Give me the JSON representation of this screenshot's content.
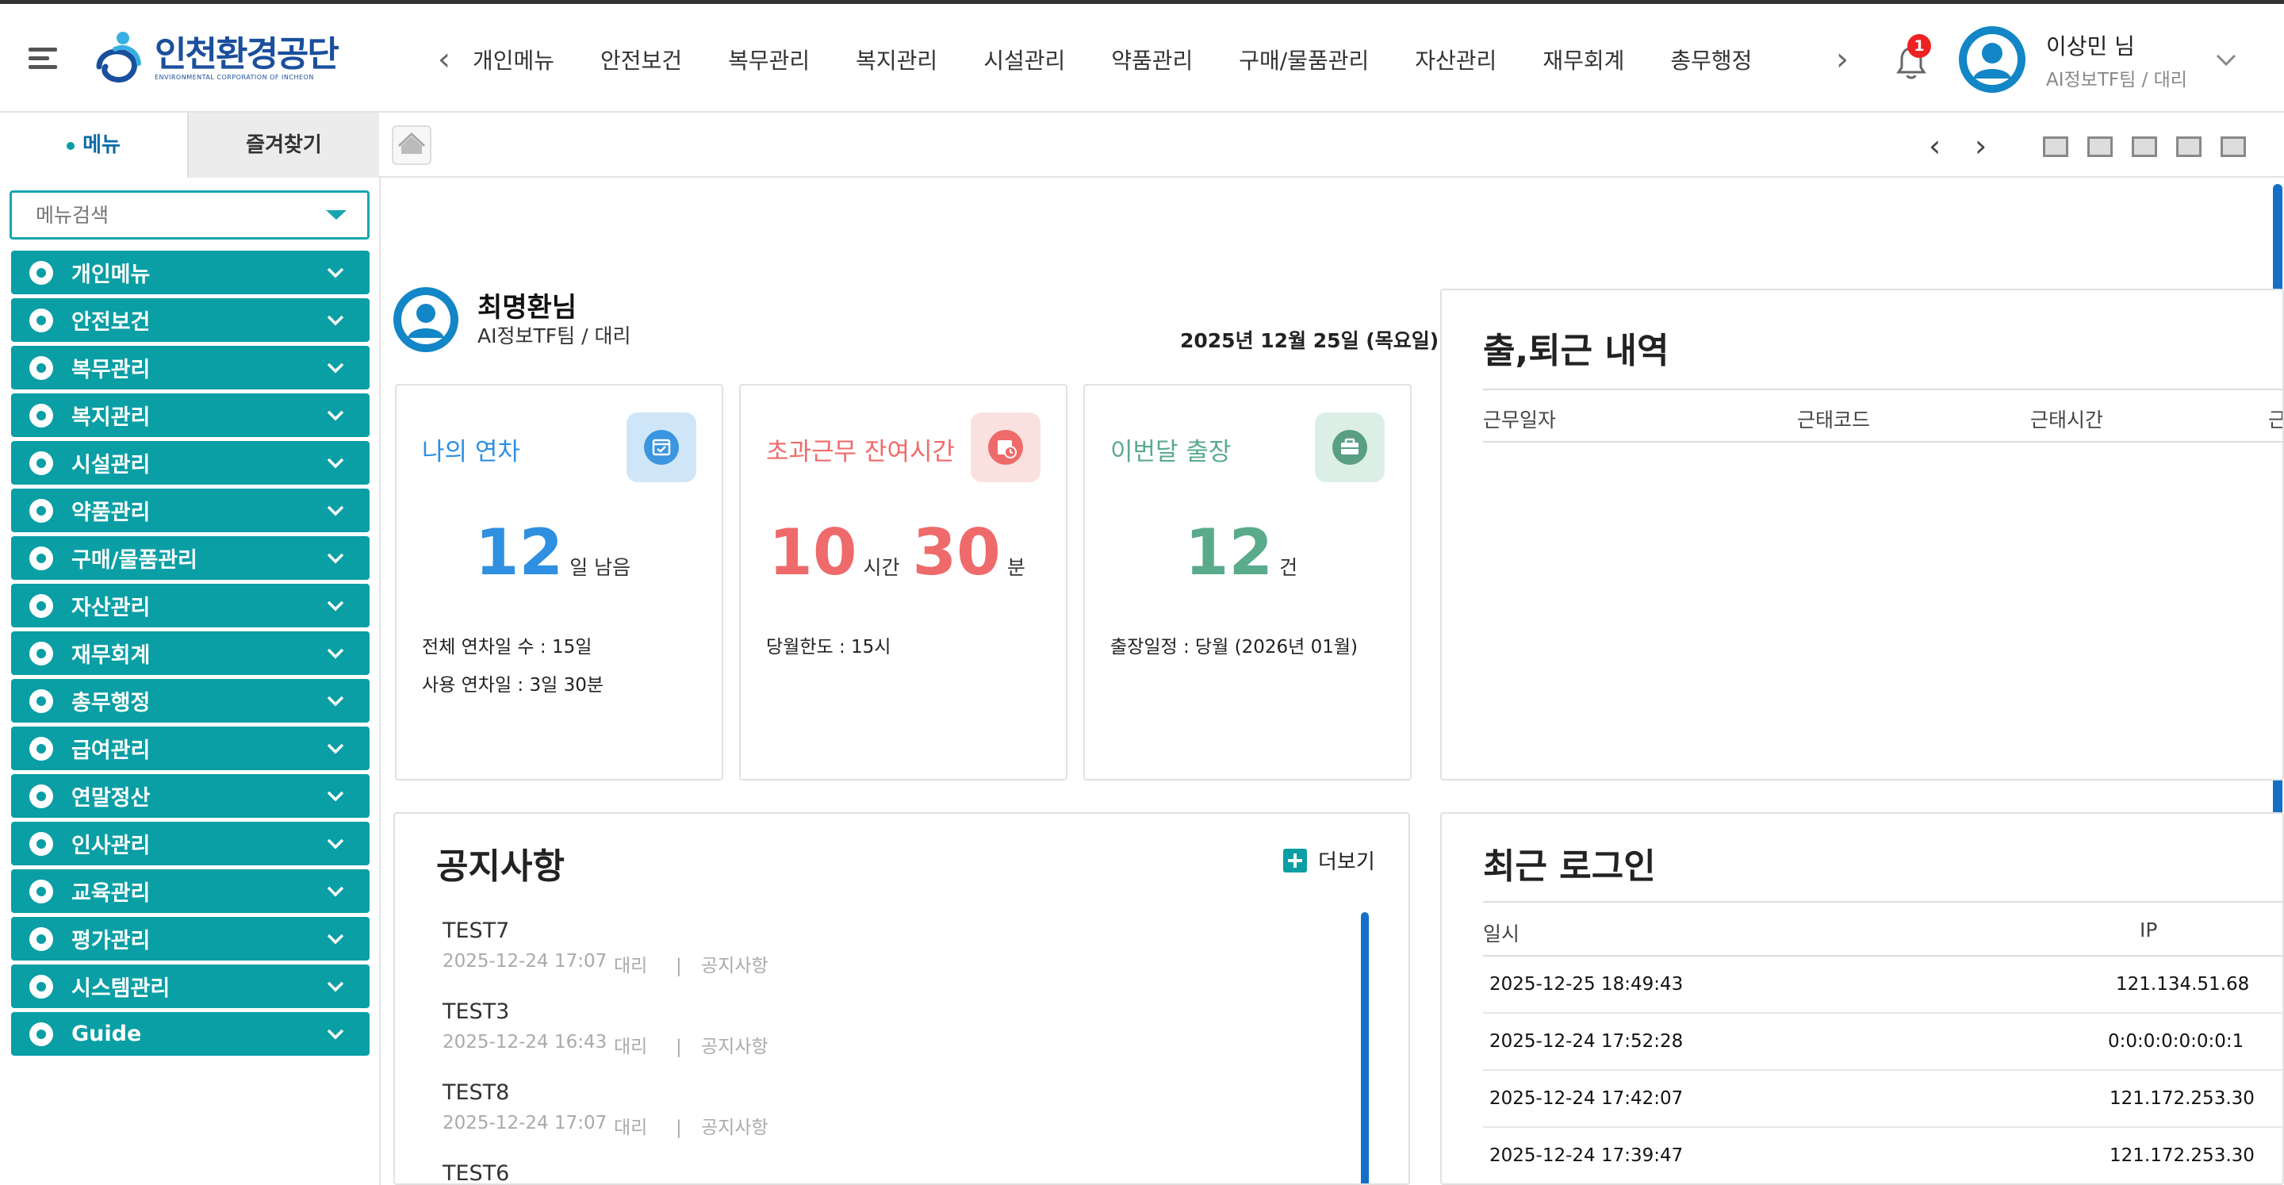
{
  "header": {
    "logo_ko": "인천환경공단",
    "logo_en": "ENVIRONMENTAL CORPORATION OF INCHEON",
    "nav": [
      "개인메뉴",
      "안전보건",
      "복무관리",
      "복지관리",
      "시설관리",
      "약품관리",
      "구매/물품관리",
      "자산관리",
      "재무회계",
      "총무행정"
    ],
    "notification_count": "1",
    "user_name": "이상민 님",
    "user_team": "AI정보TF팀 / 대리"
  },
  "tabs": {
    "menu": "메뉴",
    "favorites": "즐겨찾기"
  },
  "sidebar": {
    "search_placeholder": "메뉴검색",
    "items": [
      {
        "label": "개인메뉴",
        "icon": "id-card-icon"
      },
      {
        "label": "안전보건",
        "icon": "shield-icon"
      },
      {
        "label": "복무관리",
        "icon": "clock-user-icon"
      },
      {
        "label": "복지관리",
        "icon": "welfare-icon"
      },
      {
        "label": "시설관리",
        "icon": "tools-icon"
      },
      {
        "label": "약품관리",
        "icon": "truck-icon"
      },
      {
        "label": "구매/물품관리",
        "icon": "box-icon"
      },
      {
        "label": "자산관리",
        "icon": "database-icon"
      },
      {
        "label": "재무회계",
        "icon": "calculator-icon"
      },
      {
        "label": "총무행정",
        "icon": "bank-icon"
      },
      {
        "label": "급여관리",
        "icon": "won-icon"
      },
      {
        "label": "연말정산",
        "icon": "receipt-icon"
      },
      {
        "label": "인사관리",
        "icon": "person-frame-icon"
      },
      {
        "label": "교육관리",
        "icon": "book-icon"
      },
      {
        "label": "평가관리",
        "icon": "stamp-icon"
      },
      {
        "label": "시스템관리",
        "icon": "gear-icon"
      },
      {
        "label": "Guide",
        "icon": "help-icon"
      }
    ]
  },
  "profile": {
    "name": "최명환님",
    "team": "AI정보TF팀 / 대리",
    "date": "2025년 12월 25일 (목요일)"
  },
  "cards": {
    "leave": {
      "title": "나의 연차",
      "value": "12",
      "unit": "일 남음",
      "line1": "전체 연차일 수 : 15일",
      "line2": "사용 연차일 : 3일 30분",
      "color": "#2f8fe0"
    },
    "overtime": {
      "title": "초과근무 잔여시간",
      "hours": "10",
      "hours_unit": "시간",
      "minutes": "30",
      "minutes_unit": "분",
      "line1": "당월한도 : 15시",
      "color": "#ef6a6a"
    },
    "trip": {
      "title": "이번달 출장",
      "value": "12",
      "unit": "건",
      "line1": "출장일정 : 당월 (2026년 01월)",
      "color": "#5aaa8c"
    }
  },
  "attendance": {
    "title": "출,퇴근 내역",
    "columns": [
      "근무일자",
      "근태코드",
      "근태시간",
      "근"
    ]
  },
  "notice": {
    "title": "공지사항",
    "more": "더보기",
    "items": [
      {
        "title": "TEST7",
        "date": "2025-12-24 17:07",
        "rank": "대리",
        "sep": "|",
        "category": "공지사항"
      },
      {
        "title": "TEST3",
        "date": "2025-12-24 16:43",
        "rank": "대리",
        "sep": "|",
        "category": "공지사항"
      },
      {
        "title": "TEST8",
        "date": "2025-12-24 17:07",
        "rank": "대리",
        "sep": "|",
        "category": "공지사항"
      },
      {
        "title": "TEST6",
        "date": "",
        "rank": "",
        "sep": "",
        "category": ""
      }
    ]
  },
  "recent_login": {
    "title": "최근 로그인",
    "columns": [
      "일시",
      "IP"
    ],
    "rows": [
      {
        "time": "2025-12-25 18:49:43",
        "ip": "121.134.51.68"
      },
      {
        "time": "2025-12-24 17:52:28",
        "ip": "0:0:0:0:0:0:0:1"
      },
      {
        "time": "2025-12-24 17:42:07",
        "ip": "121.172.253.30"
      },
      {
        "time": "2025-12-24 17:39:47",
        "ip": "121.172.253.30"
      }
    ]
  }
}
